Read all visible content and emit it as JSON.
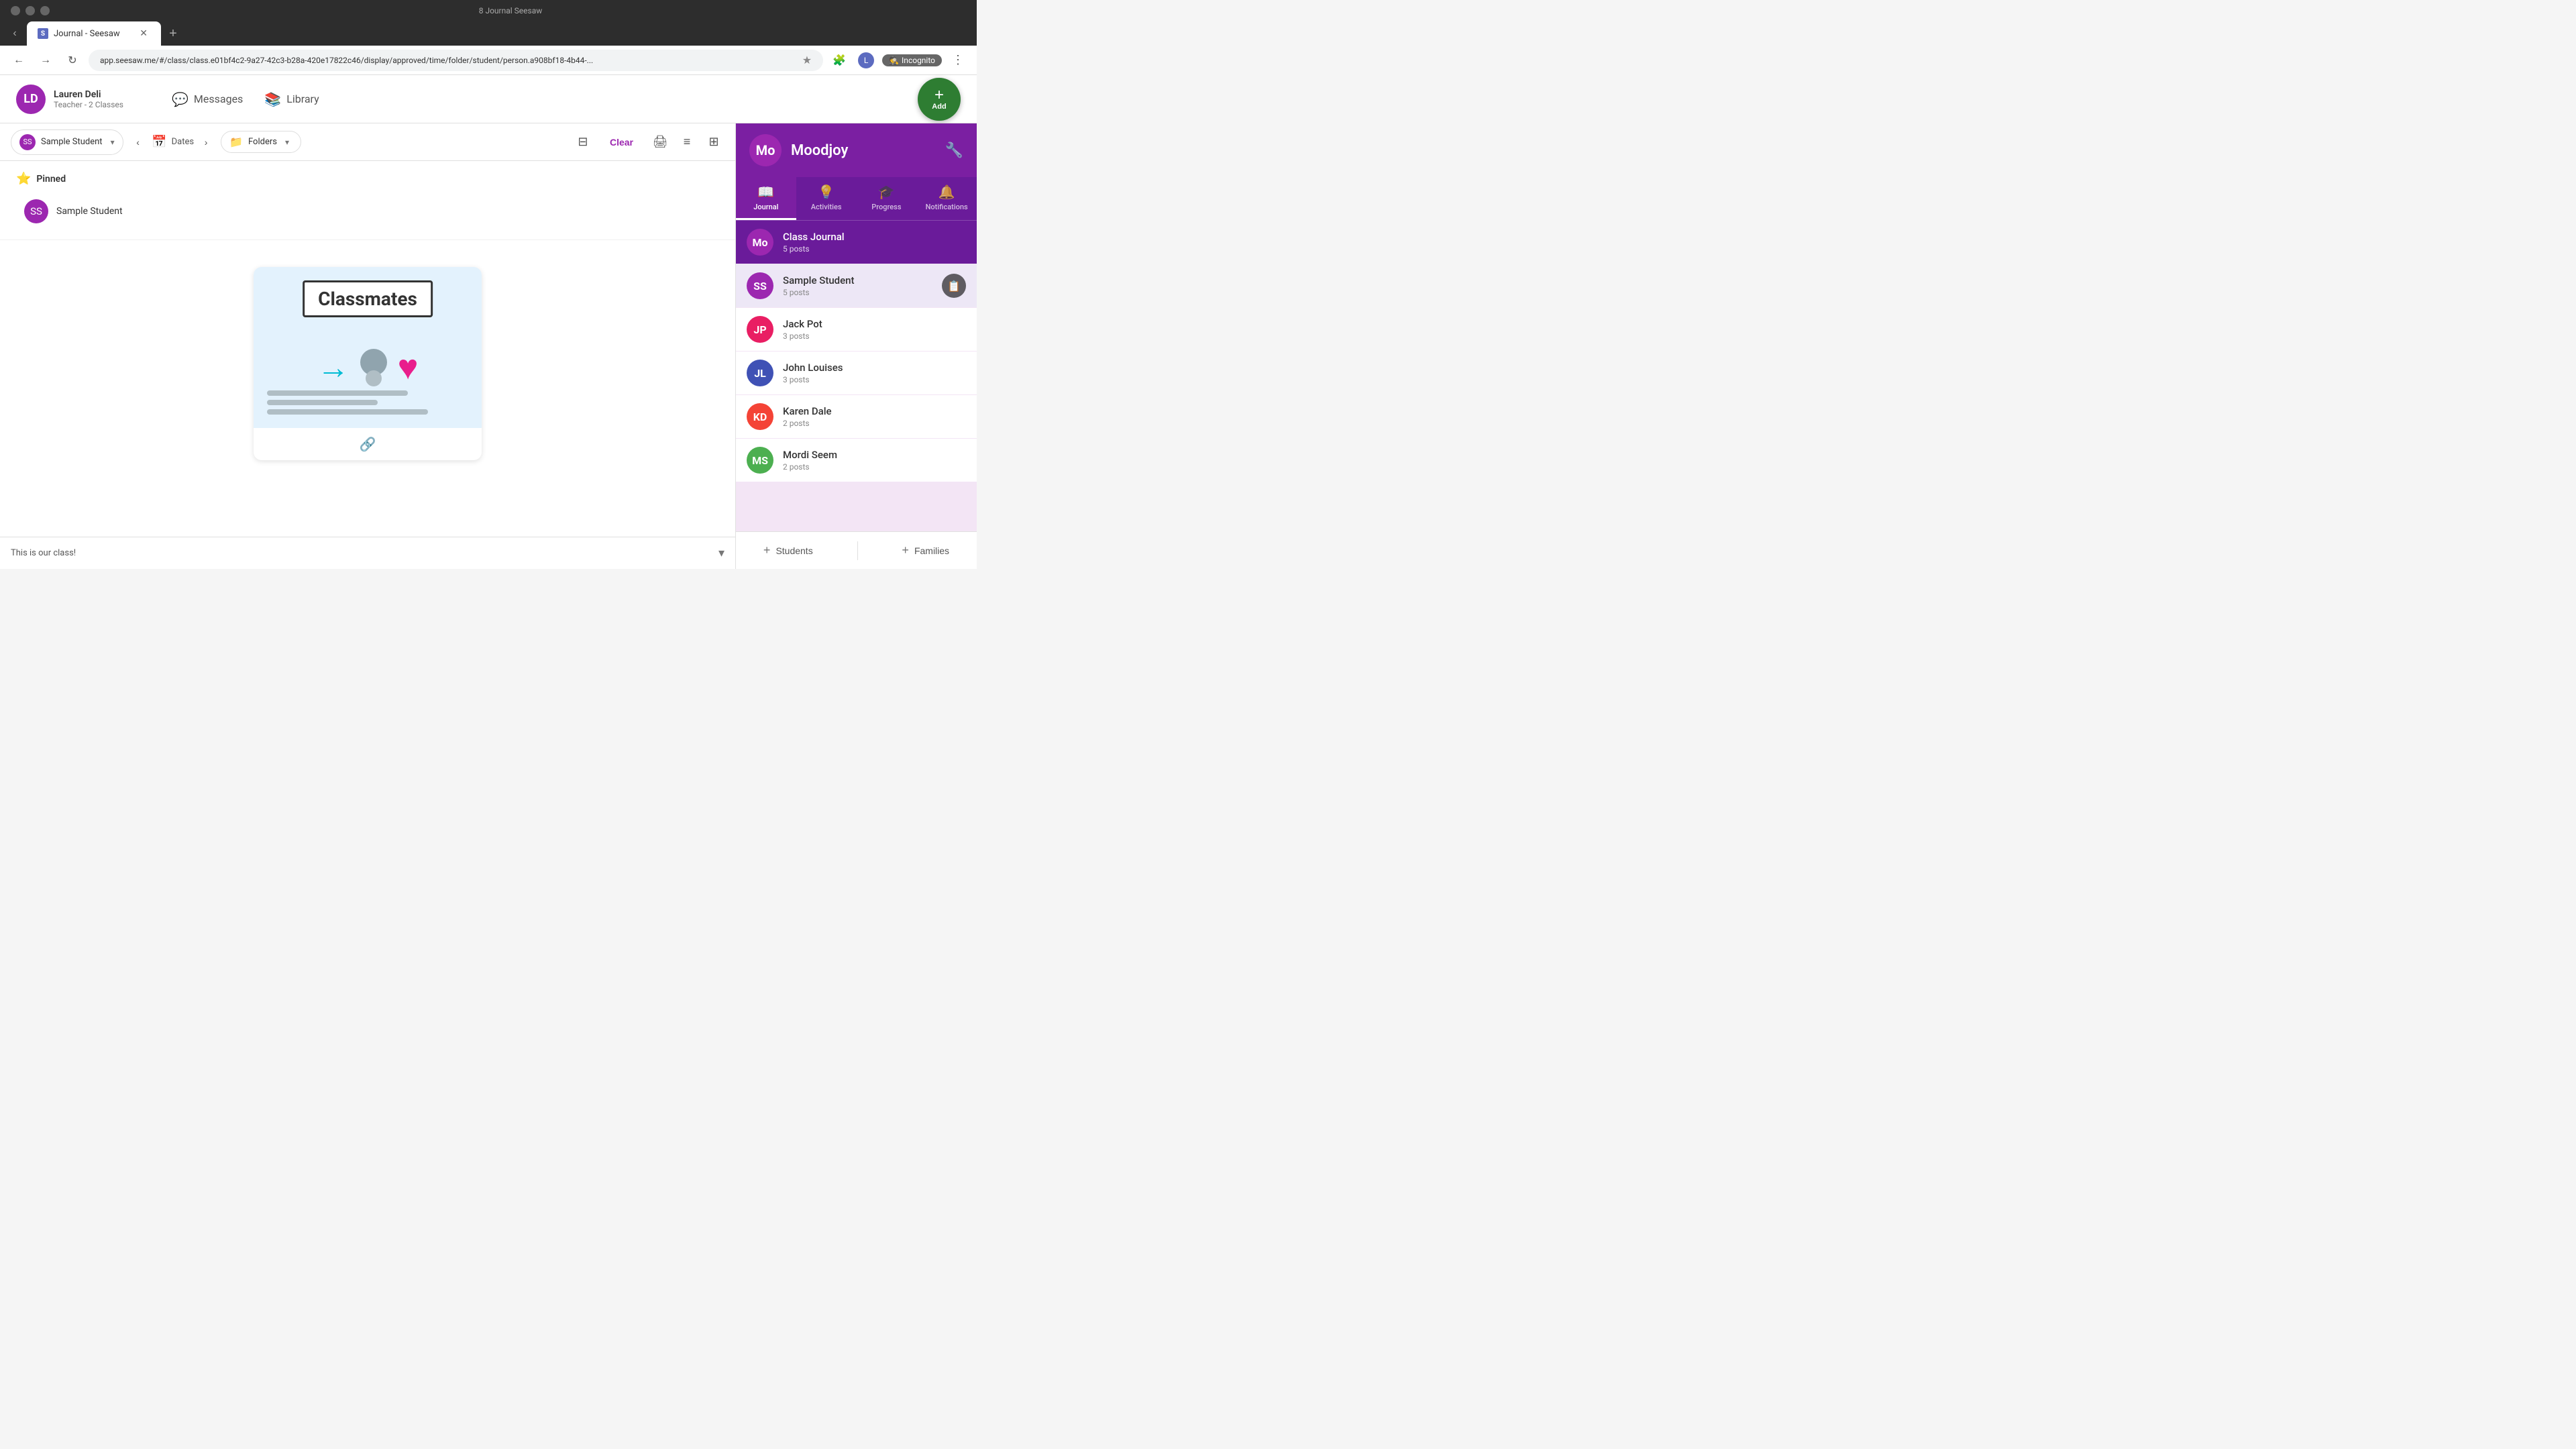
{
  "browser": {
    "tab_title": "Journal - Seesaw",
    "tab_favicon": "S",
    "url": "app.seesaw.me/#/class/class.e01bf4c2-9a27-42c3-b28a-420e17822c46/display/approved/time/folder/student/person.a908bf18-4b44-...",
    "incognito_label": "Incognito"
  },
  "header": {
    "user_name": "Lauren Deli",
    "user_role": "Teacher - 2 Classes",
    "user_initials": "LD",
    "messages_label": "Messages",
    "library_label": "Library",
    "add_label": "Add"
  },
  "toolbar": {
    "student_name": "Sample Student",
    "dates_label": "Dates",
    "folders_label": "Folders",
    "clear_label": "Clear"
  },
  "pinned": {
    "title": "Pinned",
    "student_name": "Sample Student"
  },
  "post": {
    "classmates_text": "Classmates",
    "caption": "This is our class!",
    "link_title": "link"
  },
  "sidebar": {
    "class_initial": "Mo",
    "class_name": "Moodjoy",
    "tabs": [
      {
        "label": "Journal",
        "icon": "📖",
        "active": true
      },
      {
        "label": "Activities",
        "icon": "💡",
        "active": false
      },
      {
        "label": "Progress",
        "icon": "🎓",
        "active": false
      },
      {
        "label": "Notifications",
        "icon": "🔔",
        "active": false
      }
    ],
    "class_journal": {
      "label": "Class Journal",
      "posts": "5 posts",
      "initial": "Mo"
    },
    "students": [
      {
        "name": "Sample Student",
        "posts": "5 posts",
        "initials": "SS",
        "color": "#9c27b0",
        "active": true,
        "has_action": true
      },
      {
        "name": "Jack Pot",
        "posts": "3 posts",
        "initials": "JP",
        "color": "#e91e63",
        "active": false,
        "has_action": false
      },
      {
        "name": "John Louises",
        "posts": "3 posts",
        "initials": "JL",
        "color": "#3f51b5",
        "active": false,
        "has_action": false
      },
      {
        "name": "Karen Dale",
        "posts": "2 posts",
        "initials": "KD",
        "color": "#f44336",
        "active": false,
        "has_action": false
      },
      {
        "name": "Mordi Seem",
        "posts": "2 posts",
        "initials": "MS",
        "color": "#4caf50",
        "active": false,
        "has_action": false
      }
    ],
    "footer": {
      "students_label": "Students",
      "families_label": "Families"
    }
  },
  "icons": {
    "back": "←",
    "forward": "→",
    "reload": "↻",
    "star": "★",
    "extensions": "🧩",
    "more": "⋮",
    "messages": "💬",
    "library": "📚",
    "add": "+",
    "dates": "📅",
    "folders": "📁",
    "filter": "⊟",
    "print": "🖨",
    "list": "≡",
    "grid": "⊞",
    "pin": "⭐",
    "chevron_down": "▾",
    "chevron_left": "‹",
    "chevron_right": "›",
    "link": "🔗",
    "gear": "🔧",
    "close": "✕",
    "plus": "+",
    "portfolio": "📋",
    "expand": "⌄"
  },
  "page_title": "8 Journal Seesaw"
}
